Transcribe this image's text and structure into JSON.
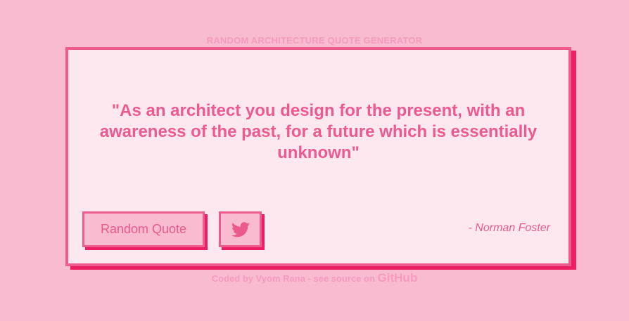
{
  "header": {
    "title": "RANDOM ARCHITECTURE QUOTE GENERATOR"
  },
  "quote": {
    "text": "\"As an architect you design for the present, with an awareness of the past, for a future which is essentially unknown\"",
    "author": "- Norman Foster"
  },
  "buttons": {
    "random_label": "Random Quote",
    "tweet_icon": "twitter-icon"
  },
  "footer": {
    "text": "Coded by Vyom Rana - see source on ",
    "link": "GitHub"
  },
  "colors": {
    "background": "#f9bbd0",
    "card": "#fde8ef",
    "accent": "#ec5a8f",
    "shadow": "#ed1f63"
  }
}
